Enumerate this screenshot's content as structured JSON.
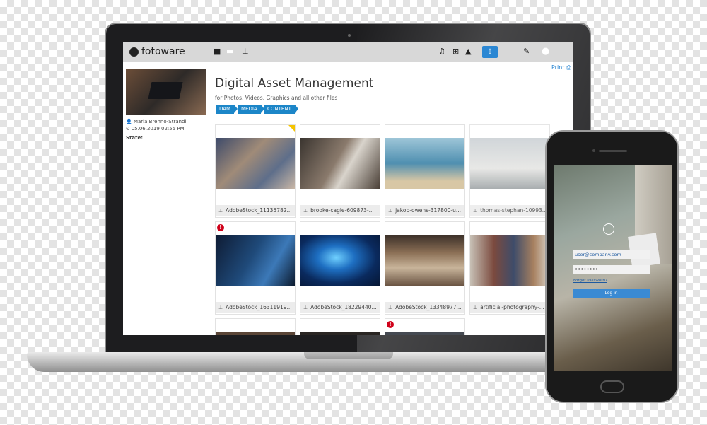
{
  "app": {
    "logo": "fotoware",
    "print_label": "Print"
  },
  "topbar": {
    "icons": [
      "folder-icon",
      "briefcase-icon",
      "pin-icon",
      "bell-icon",
      "cart-icon",
      "graduation-cap-icon",
      "upload-icon",
      "wrench-icon",
      "user-icon"
    ]
  },
  "asset": {
    "author": "Maria Brenno-Strandli",
    "date": "05.06.2019 02:55 PM",
    "state_label": "State:"
  },
  "page": {
    "title": "Digital Asset Management",
    "subtitle": "for Photos, Videos, Graphics and all other files",
    "tags": [
      "DAM",
      "MEDIA",
      "CONTENT"
    ]
  },
  "grid": {
    "files": [
      "AdobeStock_11135782...",
      "brooke-cagle-609873-...",
      "jakob-owens-317800-u...",
      "thomas-stephan-10993...",
      "AdobeStock_16311919...",
      "AdobeStock_18229440...",
      "AdobeStock_13348977...",
      "artificial-photography-..."
    ]
  },
  "phone": {
    "email_placeholder": "user@company.com",
    "password_value": "••••••••",
    "forgot_label": "Forgot Password?",
    "login_label": "Log in"
  }
}
